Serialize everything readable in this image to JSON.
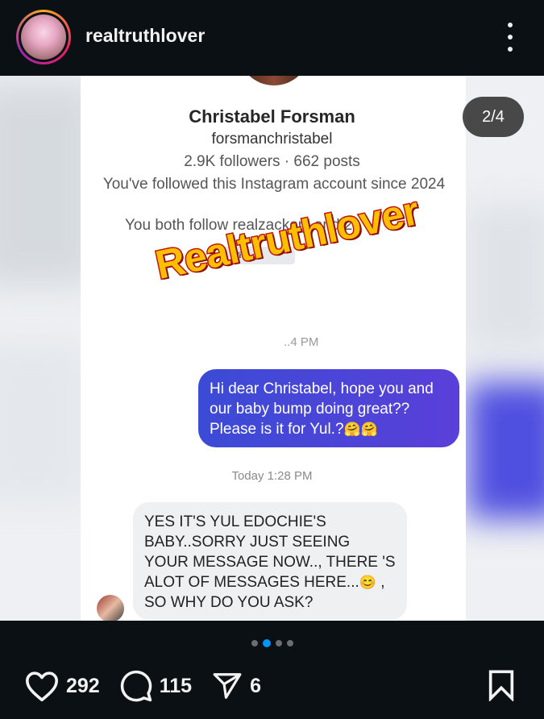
{
  "header": {
    "username": "realtruthlover"
  },
  "post": {
    "counter": "2/4",
    "profile": {
      "name": "Christabel Forsman",
      "handle": "forsmanchristabel",
      "stats": "2.9K followers · 662 posts",
      "since": "You've followed this Instagram account since 2024",
      "mutual": "You both follow realzackorji and 2"
    },
    "view_button": "Vi",
    "watermark": "Realtruthlover",
    "pm_time": "..4 PM",
    "sent_message": "Hi dear Christabel, hope you and our baby bump doing great?? Please is it for Yul.?",
    "sent_emoji": "🤗🤗",
    "today_time": "Today 1:28 PM",
    "received_message_part1": "YES IT'S YUL EDOCHIE'S BABY..SORRY JUST SEEING YOUR MESSAGE NOW.., THERE 'S ALOT OF MESSAGES HERE...",
    "received_emoji": "😊",
    "received_message_part2": " , SO WHY DO YOU ASK?"
  },
  "carousel": {
    "total": 4,
    "active_index": 1
  },
  "actions": {
    "likes": "292",
    "comments": "115",
    "shares": "6"
  },
  "icons": [
    "more-vertical-icon",
    "heart-icon",
    "comment-icon",
    "share-icon",
    "bookmark-icon"
  ]
}
